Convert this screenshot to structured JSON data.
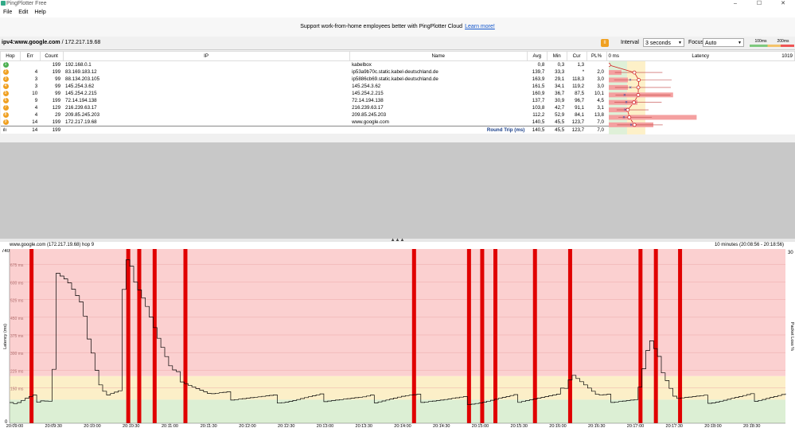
{
  "window": {
    "title": "PingPlotter Free"
  },
  "menu": [
    "File",
    "Edit",
    "Help"
  ],
  "banner": {
    "text": "Support work-from-home employees better with PingPlotter Cloud",
    "link": "Learn more!"
  },
  "target": {
    "host": "ipv4:www.google.com",
    "ip": "/ 172.217.19.68"
  },
  "controls": {
    "interval_label": "Interval",
    "interval_value": "3 seconds",
    "focus_label": "Focus",
    "focus_value": "Auto",
    "scale_low": "100ms",
    "scale_high": "200ms"
  },
  "table": {
    "headers": [
      "Hop",
      "Err",
      "Count",
      "IP",
      "Name",
      "Avg",
      "Min",
      "Cur",
      "PL%",
      "0 ms",
      "Latency",
      "1019"
    ],
    "rows": [
      {
        "hop": "1",
        "err": "",
        "count": "199",
        "ip": "192.168.0.1",
        "name": "kabelbox",
        "avg": "0,8",
        "min": "0,3",
        "cur": "1,3",
        "pl": "",
        "color": "#4caf50",
        "avg_ms": 0.8,
        "min_ms": 0.3,
        "cur_ms": 1.3,
        "pl_pct": 0
      },
      {
        "hop": "2",
        "err": "4",
        "count": "199",
        "ip": "83.169.183.12",
        "name": "ip53a9b70c.static.kabel-deutschland.de",
        "avg": "139,7",
        "min": "33,3",
        "cur": "*",
        "pl": "2,0",
        "color": "#f0a020",
        "avg_ms": 139.7,
        "min_ms": 33.3,
        "cur_ms": null,
        "pl_pct": 2.0
      },
      {
        "hop": "3",
        "err": "3",
        "count": "99",
        "ip": "88.134.203.105",
        "name": "ip5886cb69.static.kabel-deutschland.de",
        "avg": "163,9",
        "min": "29,1",
        "cur": "118,3",
        "pl": "3,0",
        "color": "#f0a020",
        "avg_ms": 163.9,
        "min_ms": 29.1,
        "cur_ms": 118.3,
        "pl_pct": 3.0
      },
      {
        "hop": "4",
        "err": "3",
        "count": "99",
        "ip": "145.254.3.62",
        "name": "145.254.3.62",
        "avg": "161,5",
        "min": "34,1",
        "cur": "119,2",
        "pl": "3,0",
        "color": "#f0a020",
        "avg_ms": 161.5,
        "min_ms": 34.1,
        "cur_ms": 119.2,
        "pl_pct": 3.0
      },
      {
        "hop": "5",
        "err": "10",
        "count": "99",
        "ip": "145.254.2.215",
        "name": "145.254.2.215",
        "avg": "160,9",
        "min": "36,7",
        "cur": "87,5",
        "pl": "10,1",
        "color": "#f0a020",
        "avg_ms": 160.9,
        "min_ms": 36.7,
        "cur_ms": 87.5,
        "pl_pct": 10.1
      },
      {
        "hop": "6",
        "err": "9",
        "count": "199",
        "ip": "72.14.194.138",
        "name": "72.14.194.138",
        "avg": "137,7",
        "min": "30,9",
        "cur": "96,7",
        "pl": "4,5",
        "color": "#f0a020",
        "avg_ms": 137.7,
        "min_ms": 30.9,
        "cur_ms": 96.7,
        "pl_pct": 4.5
      },
      {
        "hop": "7",
        "err": "4",
        "count": "129",
        "ip": "216.239.63.17",
        "name": "216.239.63.17",
        "avg": "103,8",
        "min": "42,7",
        "cur": "91,1",
        "pl": "3,1",
        "color": "#f0a020",
        "avg_ms": 103.8,
        "min_ms": 42.7,
        "cur_ms": 91.1,
        "pl_pct": 3.1
      },
      {
        "hop": "8",
        "err": "4",
        "count": "29",
        "ip": "209.85.245.203",
        "name": "209.85.245.203",
        "avg": "112,2",
        "min": "52,9",
        "cur": "84,1",
        "pl": "13,8",
        "color": "#f0a020",
        "avg_ms": 112.2,
        "min_ms": 52.9,
        "cur_ms": 84.1,
        "pl_pct": 13.8
      },
      {
        "hop": "9",
        "err": "14",
        "count": "199",
        "ip": "172.217.19.68",
        "name": "www.google.com",
        "avg": "140,5",
        "min": "45,5",
        "cur": "123,7",
        "pl": "7,0",
        "color": "#f0a020",
        "avg_ms": 140.5,
        "min_ms": 45.5,
        "cur_ms": 123.7,
        "pl_pct": 7.0
      }
    ],
    "summary": {
      "err": "14",
      "count": "199",
      "label": "Round Trip (ms)",
      "avg": "140,5",
      "min": "45,5",
      "cur": "123,7",
      "pl": "7,0",
      "focus": "Focus: 20:08:56 - 20:18:5"
    }
  },
  "graph": {
    "header_left": "www.google.com (172.217.19.68) hop 9",
    "header_right": "10 minutes (20:08:56 - 20:18:56)",
    "y_axis_label": "Latency (ms)",
    "y2_axis_label": "Packet Loss %",
    "y_max": "740",
    "y_min": "0",
    "y2_max": "30",
    "gridlines": [
      "675 ms",
      "600 ms",
      "525 ms",
      "450 ms",
      "375 ms",
      "300 ms",
      "225 ms",
      "150 ms"
    ],
    "x_ticks": [
      "20:09:00",
      "20:09:30",
      "20:10:00",
      "20:10:30",
      "20:11:00",
      "20:11:30",
      "20:12:00",
      "20:12:30",
      "20:13:00",
      "20:13:30",
      "20:14:00",
      "20:14:30",
      "20:15:00",
      "20:15:30",
      "20:16:00",
      "20:16:30",
      "20:17:00",
      "20:17:30",
      "20:18:00",
      "20:18:30"
    ],
    "loss_positions_s": [
      10,
      54,
      59,
      66,
      80,
      184,
      209,
      215,
      221,
      239,
      255,
      287,
      294,
      305
    ]
  },
  "chart_data": {
    "type": "line",
    "title": "www.google.com (172.217.19.68) hop 9",
    "xlabel": "",
    "ylabel": "Latency (ms)",
    "ylim": [
      0,
      740
    ],
    "xlim": [
      "20:08:56",
      "20:18:56"
    ],
    "series": [
      {
        "name": "",
        "x": [
          "20:08:56",
          "20:09:00",
          "20:09:10",
          "20:09:20",
          "20:09:28",
          "20:09:32",
          "20:09:40",
          "20:09:50",
          "20:10:00",
          "20:10:04",
          "20:10:10",
          "20:10:20",
          "20:10:24",
          "20:10:30",
          "20:10:40",
          "20:10:50",
          "20:11:00",
          "20:11:30",
          "20:12:00",
          "20:12:30",
          "20:13:00",
          "20:13:30",
          "20:14:00",
          "20:14:30",
          "20:15:00",
          "20:15:30",
          "20:16:00",
          "20:16:10",
          "20:16:30",
          "20:17:00",
          "20:17:10",
          "20:17:30",
          "20:18:00",
          "20:18:30",
          "20:18:56"
        ],
        "y": [
          90,
          80,
          100,
          110,
          100,
          640,
          600,
          500,
          290,
          180,
          120,
          130,
          700,
          640,
          520,
          360,
          220,
          120,
          110,
          100,
          110,
          100,
          110,
          100,
          95,
          105,
          110,
          220,
          110,
          100,
          350,
          110,
          100,
          110,
          120
        ]
      }
    ],
    "grid": true,
    "legend": "none"
  }
}
